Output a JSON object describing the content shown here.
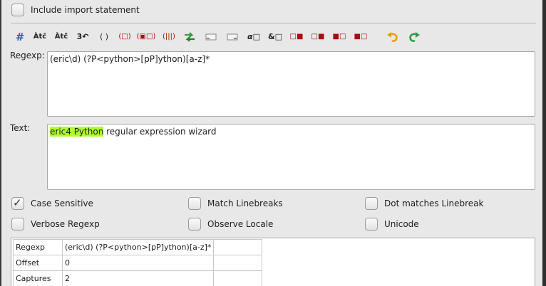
{
  "include_import": {
    "label": "Include import statement",
    "checked": false
  },
  "toolbar": {
    "tools": [
      {
        "name": "comment-tool",
        "glyph": "#"
      },
      {
        "name": "any-char-tool",
        "glyph": "Àtč"
      },
      {
        "name": "char-class-tool",
        "glyph": "Àtč̌"
      },
      {
        "name": "repeat-tool",
        "glyph": "3↶"
      },
      {
        "name": "group-tool",
        "glyph": "( )"
      },
      {
        "name": "named-group-tool",
        "glyph": "(□)"
      },
      {
        "name": "non-capture-group-tool",
        "glyph": "(▣□)"
      },
      {
        "name": "alternative-group-tool",
        "glyph": "(|||)"
      },
      {
        "name": "backreference-tool",
        "glyph": "⇆"
      },
      {
        "name": "begin-line-tool",
        "glyph": "▭"
      },
      {
        "name": "end-line-tool",
        "glyph": "▭"
      },
      {
        "name": "word-boundary-tool",
        "glyph": "α□"
      },
      {
        "name": "non-word-boundary-tool",
        "glyph": "&□"
      },
      {
        "name": "lookahead-tool",
        "glyph": "□■"
      },
      {
        "name": "neg-lookahead-tool",
        "glyph": "□■"
      },
      {
        "name": "lookbehind-tool",
        "glyph": "■□"
      },
      {
        "name": "neg-lookbehind-tool",
        "glyph": "■□"
      }
    ],
    "undo_icon": "undo-icon",
    "redo_icon": "redo-icon"
  },
  "regexp": {
    "label": "Regexp:",
    "value": "(eric\\d) (?P<python>[pP]ython)[a-z]*"
  },
  "text": {
    "label": "Text:",
    "match": "eric4 Python",
    "rest": " regular expression wizard"
  },
  "options": [
    {
      "label": "Case Sensitive",
      "checked": true
    },
    {
      "label": "Match Linebreaks",
      "checked": false
    },
    {
      "label": "Dot matches Linebreak",
      "checked": false
    },
    {
      "label": "Verbose Regexp",
      "checked": false
    },
    {
      "label": "Observe Locale",
      "checked": false
    },
    {
      "label": "Unicode",
      "checked": false
    }
  ],
  "result_table": {
    "rows": [
      [
        "Regexp",
        "(eric\\d) (?P<python>[pP]ython)[a-z]*",
        ""
      ],
      [
        "Offset",
        "0",
        ""
      ],
      [
        "Captures",
        "2",
        ""
      ]
    ]
  },
  "colors": {
    "highlight": "#adff2f",
    "undo": "#e8a000",
    "redo": "#2e9e3e",
    "comment": "#2a5db0"
  }
}
